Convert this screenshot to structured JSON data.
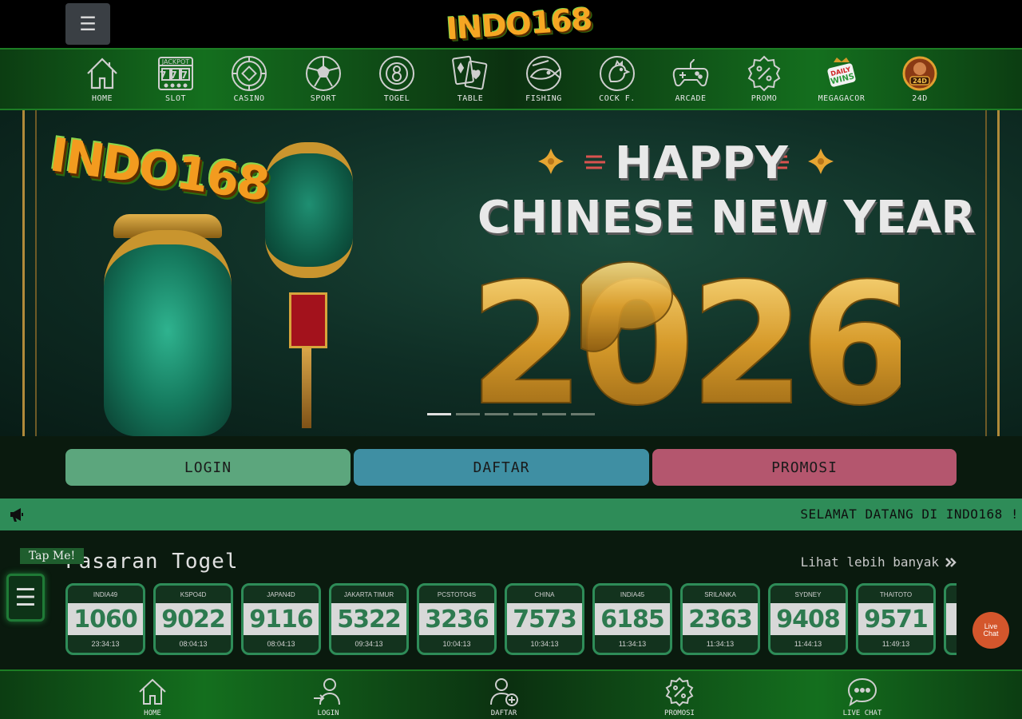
{
  "header": {
    "menu_icon": "☰",
    "logo_text": "INDO168"
  },
  "categories": [
    {
      "label": "HOME",
      "icon": "home-icon"
    },
    {
      "label": "SLOT",
      "icon": "slot-machine-icon"
    },
    {
      "label": "CASINO",
      "icon": "roulette-icon"
    },
    {
      "label": "SPORT",
      "icon": "soccer-ball-icon"
    },
    {
      "label": "TOGEL",
      "icon": "lottery-ball-icon"
    },
    {
      "label": "TABLE",
      "icon": "playing-cards-icon"
    },
    {
      "label": "FISHING",
      "icon": "fish-icon"
    },
    {
      "label": "COCK F.",
      "icon": "rooster-icon"
    },
    {
      "label": "ARCADE",
      "icon": "gamepad-icon"
    },
    {
      "label": "PROMO",
      "icon": "discount-badge-icon"
    },
    {
      "label": "MEGAGACOR",
      "icon": "daily-wins-icon"
    },
    {
      "label": "24D",
      "icon": "24d-game-icon"
    }
  ],
  "slot_badge": {
    "top": "JACKPOT",
    "reels": "777"
  },
  "dailywins_badge": {
    "line1": "DAILY",
    "line2": "WINS"
  },
  "banner": {
    "logo_text": "INDO168",
    "line1": "HAPPY",
    "line2": "CHINESE NEW YEAR",
    "year": "2026",
    "slides": 6,
    "active_slide": 0
  },
  "auth": {
    "login": "LOGIN",
    "daftar": "DAFTAR",
    "promosi": "PROMOSI"
  },
  "marquee": {
    "text": "SELAMAT DATANG DI INDO168 !"
  },
  "pasaran": {
    "tap_me": "Tap Me!",
    "title": "Pasaran Togel",
    "see_more": "Lihat lebih banyak",
    "markets": [
      {
        "name": "INDIA49",
        "result": "1060",
        "time": "23:34:13"
      },
      {
        "name": "KSPO4D",
        "result": "9022",
        "time": "08:04:13"
      },
      {
        "name": "JAPAN4D",
        "result": "9116",
        "time": "08:04:13"
      },
      {
        "name": "JAKARTA TIMUR",
        "result": "5322",
        "time": "09:34:13"
      },
      {
        "name": "PCSTOTO4S",
        "result": "3236",
        "time": "10:04:13"
      },
      {
        "name": "CHINA",
        "result": "7573",
        "time": "10:34:13"
      },
      {
        "name": "INDIA45",
        "result": "6185",
        "time": "11:34:13"
      },
      {
        "name": "SRILANKA",
        "result": "2363",
        "time": "11:34:13"
      },
      {
        "name": "SYDNEY",
        "result": "9408",
        "time": "11:44:13"
      },
      {
        "name": "THAITOTO",
        "result": "9571",
        "time": "11:49:13"
      },
      {
        "name": "",
        "result": "",
        "time": ""
      }
    ],
    "livechat_float": {
      "line1": "Live",
      "line2": "Chat"
    }
  },
  "bottom_nav": [
    {
      "label": "HOME",
      "icon": "home-icon"
    },
    {
      "label": "LOGIN",
      "icon": "user-login-icon"
    },
    {
      "label": "DAFTAR",
      "icon": "user-add-icon"
    },
    {
      "label": "PROMOSI",
      "icon": "discount-badge-icon"
    },
    {
      "label": "LIVE CHAT",
      "icon": "chat-bubble-icon"
    }
  ],
  "colors": {
    "nav_green": "#146f1e",
    "marquee_bg": "#2e8c58",
    "login_btn": "#5ca67d",
    "daftar_btn": "#3f8fa3",
    "promosi_btn": "#b4566e",
    "result_text": "#2d7a4f"
  }
}
